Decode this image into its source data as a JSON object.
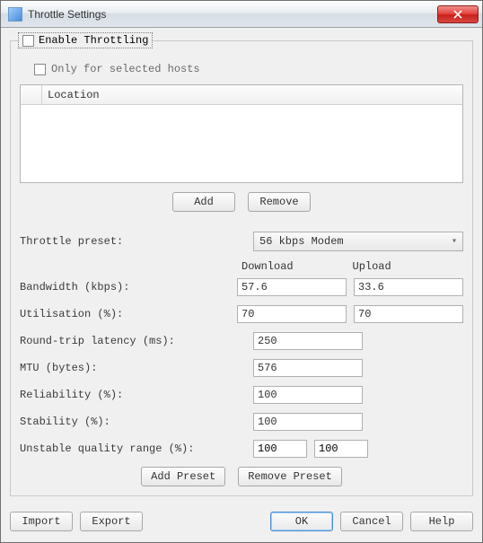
{
  "window": {
    "title": "Throttle Settings"
  },
  "groupbox": {
    "enable_label": "Enable Throttling",
    "selected_hosts_label": "Only for selected hosts",
    "location_header": "Location",
    "add_label": "Add",
    "remove_label": "Remove"
  },
  "form": {
    "preset_label": "Throttle preset:",
    "preset_value": "56 kbps Modem",
    "download_header": "Download",
    "upload_header": "Upload",
    "bandwidth_label": "Bandwidth (kbps):",
    "bandwidth_download": "57.6",
    "bandwidth_upload": "33.6",
    "utilisation_label": "Utilisation (%):",
    "utilisation_download": "70",
    "utilisation_upload": "70",
    "latency_label": "Round-trip latency (ms):",
    "latency_value": "250",
    "mtu_label": "MTU (bytes):",
    "mtu_value": "576",
    "reliability_label": "Reliability (%):",
    "reliability_value": "100",
    "stability_label": "Stability (%):",
    "stability_value": "100",
    "unstable_label": "Unstable quality range (%):",
    "unstable_min": "100",
    "unstable_max": "100",
    "add_preset_label": "Add Preset",
    "remove_preset_label": "Remove Preset"
  },
  "buttons": {
    "import": "Import",
    "export": "Export",
    "ok": "OK",
    "cancel": "Cancel",
    "help": "Help"
  }
}
